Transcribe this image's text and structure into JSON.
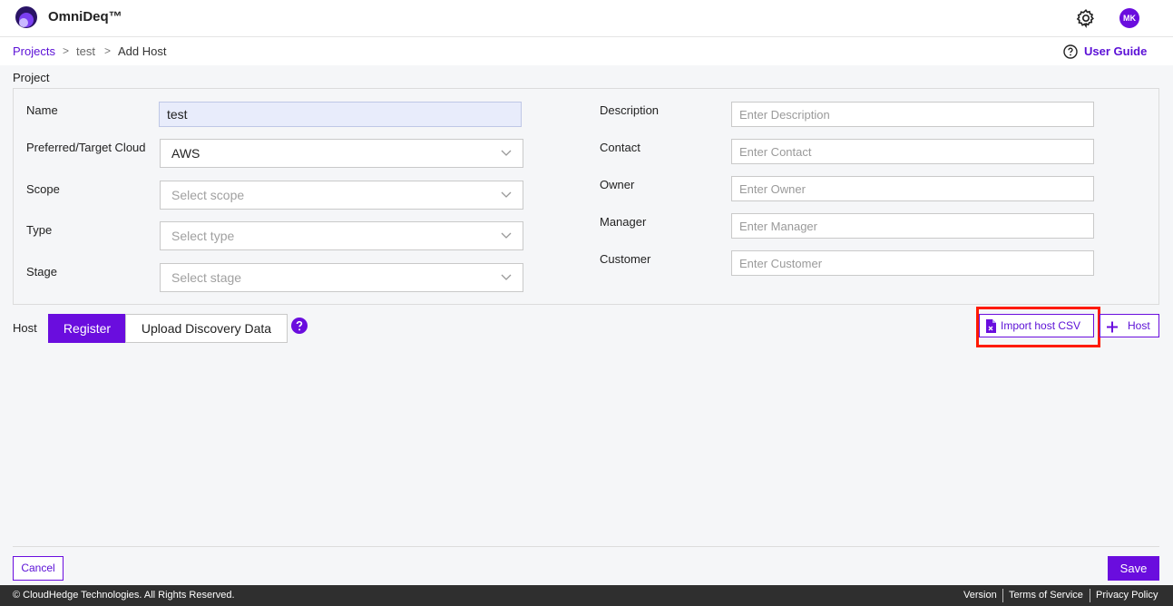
{
  "app": {
    "title": "OmniDeq™"
  },
  "header": {
    "settings_icon": "gear-icon",
    "avatar_initials": "MK"
  },
  "breadcrumb": {
    "root": "Projects",
    "project": "test",
    "current": "Add Host",
    "separator": ">"
  },
  "user_guide": {
    "label": "User Guide"
  },
  "project_section": {
    "title": "Project",
    "name": {
      "label": "Name",
      "value": "test"
    },
    "preferred_cloud": {
      "label": "Preferred/Target Cloud",
      "value": "AWS"
    },
    "scope": {
      "label": "Scope",
      "placeholder": "Select scope"
    },
    "type": {
      "label": "Type",
      "placeholder": "Select type"
    },
    "stage": {
      "label": "Stage",
      "placeholder": "Select stage"
    },
    "description": {
      "label": "Description",
      "placeholder": "Enter Description"
    },
    "contact": {
      "label": "Contact",
      "placeholder": "Enter Contact"
    },
    "owner": {
      "label": "Owner",
      "placeholder": "Enter Owner"
    },
    "manager": {
      "label": "Manager",
      "placeholder": "Enter Manager"
    },
    "customer": {
      "label": "Customer",
      "placeholder": "Enter Customer"
    }
  },
  "host_section": {
    "label": "Host",
    "tabs": [
      {
        "label": "Register",
        "active": true
      },
      {
        "label": "Upload Discovery Data",
        "active": false
      }
    ],
    "import_csv_label": "Import host CSV",
    "add_host_label": "Host"
  },
  "actions": {
    "cancel_label": "Cancel",
    "save_label": "Save"
  },
  "footer": {
    "copyright": "© CloudHedge Technologies. All Rights Reserved.",
    "links": [
      "Version",
      "Terms of Service",
      "Privacy Policy"
    ]
  },
  "colors": {
    "accent": "#6a0dde",
    "highlight": "#ff1a00",
    "footer_bg": "#2f2f2f"
  }
}
